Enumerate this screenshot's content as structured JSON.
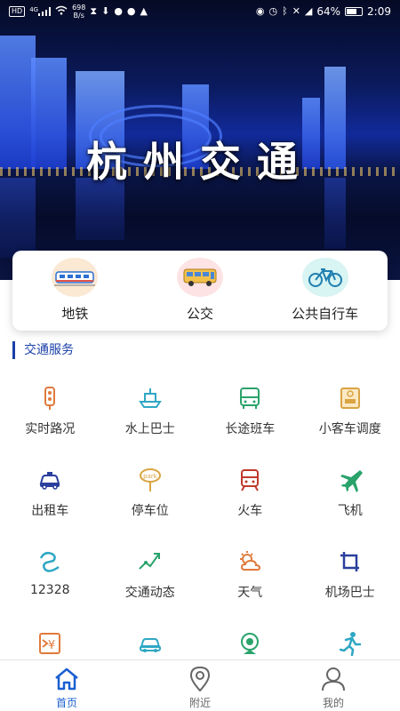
{
  "status_bar": {
    "network_badge": "HD",
    "signal_label": "4G",
    "speed_value": "698",
    "speed_unit": "B/s",
    "battery": "64%",
    "time": "2:09"
  },
  "banner": {
    "title": "杭州交通"
  },
  "top_shortcuts": [
    {
      "label": "地铁",
      "icon": "metro-train-icon",
      "bg": "#fbe9d4"
    },
    {
      "label": "公交",
      "icon": "bus-icon",
      "bg": "#fde3e3"
    },
    {
      "label": "公共自行车",
      "icon": "bicycle-icon",
      "bg": "#d8f4f3"
    }
  ],
  "section": {
    "title": "交通服务"
  },
  "services": [
    {
      "label": "实时路况",
      "icon": "traffic-light-icon",
      "color": "#e07a3c"
    },
    {
      "label": "水上巴士",
      "icon": "water-bus-icon",
      "color": "#2fa7c4"
    },
    {
      "label": "长途班车",
      "icon": "coach-bus-icon",
      "color": "#2aa36b"
    },
    {
      "label": "小客车调度",
      "icon": "pass-card-icon",
      "color": "#d9a441"
    },
    {
      "label": "出租车",
      "icon": "taxi-icon",
      "color": "#2a3f9c"
    },
    {
      "label": "停车位",
      "icon": "parking-sign-icon",
      "color": "#d9a441"
    },
    {
      "label": "火车",
      "icon": "train-icon",
      "color": "#c0392b"
    },
    {
      "label": "飞机",
      "icon": "airplane-icon",
      "color": "#2aa36b"
    },
    {
      "label": "12328",
      "icon": "hotline-icon",
      "color": "#2fa7c4"
    },
    {
      "label": "交通动态",
      "icon": "traffic-news-icon",
      "color": "#2aa36b"
    },
    {
      "label": "天气",
      "icon": "weather-icon",
      "color": "#e07a3c"
    },
    {
      "label": "机场巴士",
      "icon": "airport-bus-icon",
      "color": "#2a3f9c"
    },
    {
      "label": "",
      "icon": "toll-fee-icon",
      "color": "#e07a3c"
    },
    {
      "label": "",
      "icon": "car-icon",
      "color": "#2fa7c4"
    },
    {
      "label": "",
      "icon": "camera-icon",
      "color": "#2aa36b"
    },
    {
      "label": "",
      "icon": "runner-icon",
      "color": "#2fa7c4"
    }
  ],
  "bottom_nav": [
    {
      "label": "首页",
      "icon": "home-icon",
      "active": true
    },
    {
      "label": "附近",
      "icon": "location-pin-icon",
      "active": false
    },
    {
      "label": "我的",
      "icon": "user-icon",
      "active": false
    }
  ],
  "colors": {
    "accent": "#1a5fd1",
    "section_title": "#1a3fa8"
  }
}
